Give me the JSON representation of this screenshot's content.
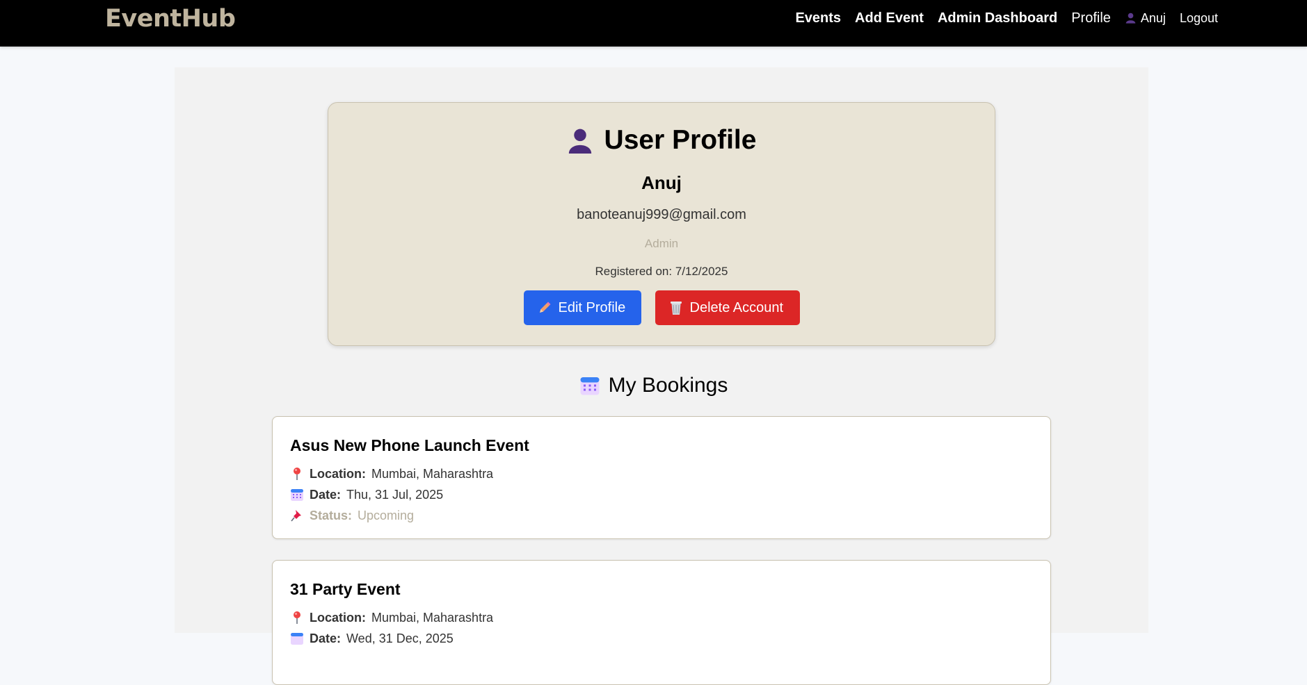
{
  "app": {
    "brand": "EventHub"
  },
  "nav": {
    "events": "Events",
    "add_event": "Add Event",
    "admin_dashboard": "Admin Dashboard",
    "profile": "Profile",
    "user_name": "Anuj",
    "logout": "Logout"
  },
  "profile": {
    "title": "User Profile",
    "name": "Anuj",
    "email": "banoteanuj999@gmail.com",
    "role": "Admin",
    "registered": "Registered on: 7/12/2025",
    "edit_label": "Edit Profile",
    "delete_label": "Delete Account"
  },
  "bookings": {
    "title": "My Bookings",
    "location_label": "Location:",
    "date_label": "Date:",
    "status_label": "Status:",
    "items": [
      {
        "title": "Asus New Phone Launch Event",
        "location": "Mumbai, Maharashtra",
        "date": "Thu, 31 Jul, 2025",
        "status": "Upcoming"
      },
      {
        "title": "31 Party Event",
        "location": "Mumbai, Maharashtra",
        "date": "Wed, 31 Dec, 2025"
      }
    ]
  },
  "colors": {
    "navbar_bg": "#000000",
    "brand": "#bfb49e",
    "profile_card_bg": "#e9e4d6",
    "edit_button": "#2563eb",
    "delete_button": "#dc2626",
    "muted_text": "#b4ad9c"
  },
  "icons": {
    "user": "user-silhouette-icon",
    "edit": "pencil-icon",
    "delete": "wastebasket-icon",
    "calendar": "calendar-icon",
    "location": "round-pushpin-icon",
    "status": "pushpin-icon"
  }
}
